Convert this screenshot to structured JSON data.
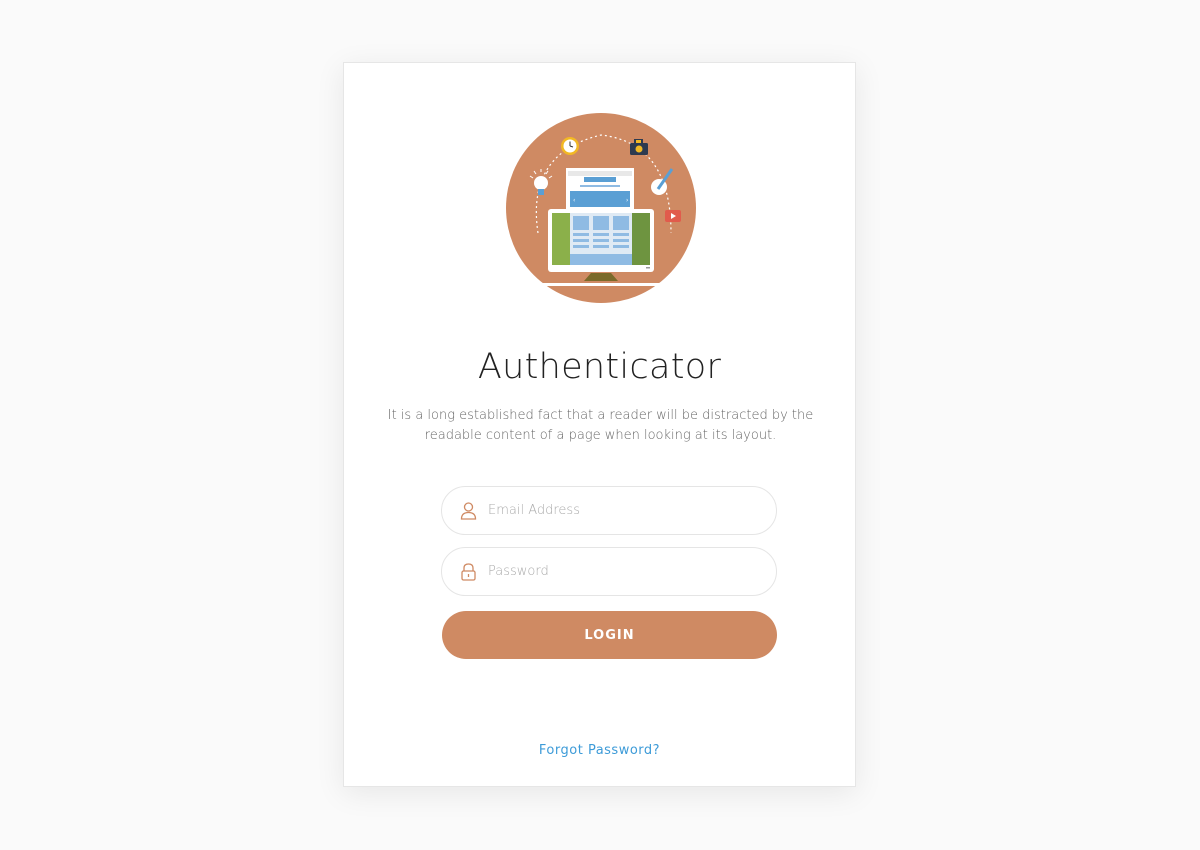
{
  "auth": {
    "title": "Authenticator",
    "description": "It is a long established fact that a reader will be distracted by the readable content of a page when looking at its layout.",
    "email": {
      "placeholder": "Email Address",
      "value": ""
    },
    "password": {
      "placeholder": "Password",
      "value": ""
    },
    "login_label": "LOGIN",
    "forgot_label": "Forgot Password?"
  },
  "icons": {
    "illustration": "website-design-illustration",
    "email": "user-icon",
    "password": "lock-icon"
  },
  "colors": {
    "accent": "#cf8a63",
    "link": "#3d9bd8",
    "background": "#fafafa",
    "card": "#ffffff",
    "title": "#222222"
  }
}
